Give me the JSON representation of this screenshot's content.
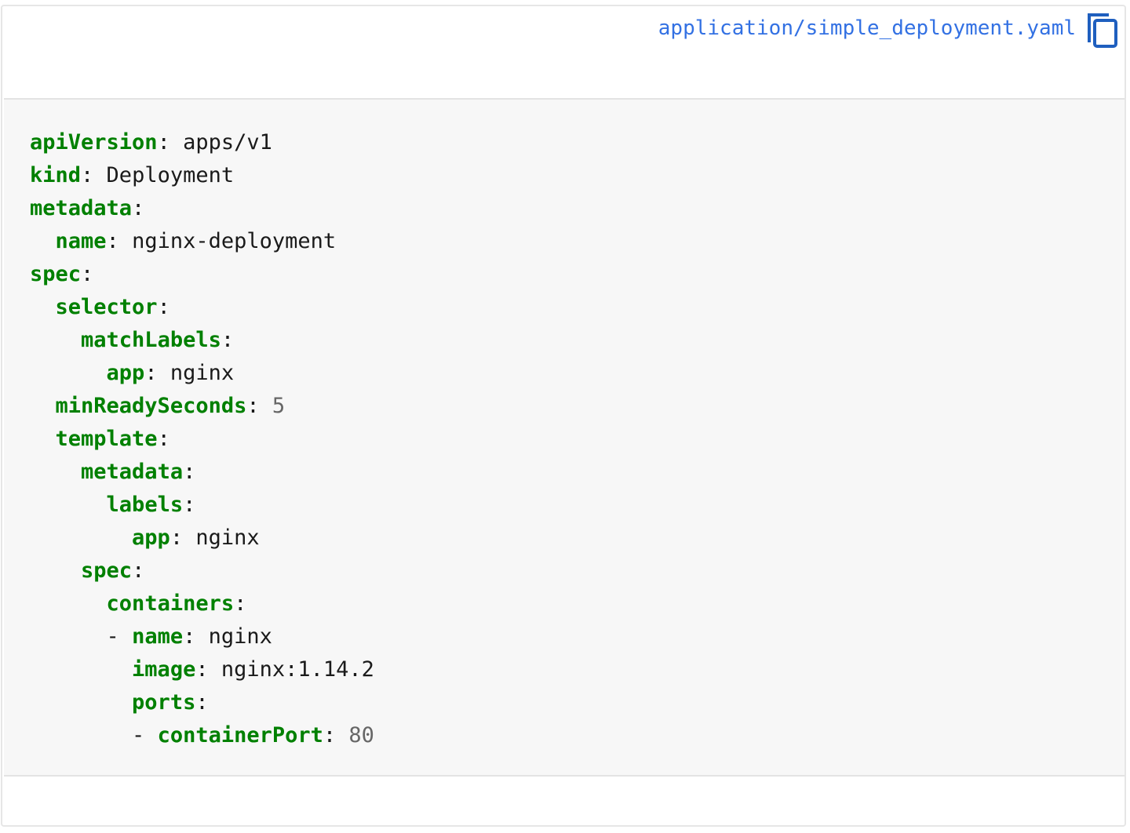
{
  "file": {
    "path": "application/simple_deployment.yaml",
    "copy_icon": "copy-icon",
    "link_color": "#3371e3"
  },
  "code": {
    "key_color": "#008000",
    "lines": [
      {
        "indent": "",
        "dash": "",
        "key": "apiVersion",
        "sep": ":",
        "value": " apps/v1",
        "type": "str"
      },
      {
        "indent": "",
        "dash": "",
        "key": "kind",
        "sep": ":",
        "value": " Deployment",
        "type": "str"
      },
      {
        "indent": "",
        "dash": "",
        "key": "metadata",
        "sep": ":",
        "value": "",
        "type": "str"
      },
      {
        "indent": "  ",
        "dash": "",
        "key": "name",
        "sep": ":",
        "value": " nginx-deployment",
        "type": "str"
      },
      {
        "indent": "",
        "dash": "",
        "key": "spec",
        "sep": ":",
        "value": "",
        "type": "str"
      },
      {
        "indent": "  ",
        "dash": "",
        "key": "selector",
        "sep": ":",
        "value": "",
        "type": "str"
      },
      {
        "indent": "    ",
        "dash": "",
        "key": "matchLabels",
        "sep": ":",
        "value": "",
        "type": "str"
      },
      {
        "indent": "      ",
        "dash": "",
        "key": "app",
        "sep": ":",
        "value": " nginx",
        "type": "str"
      },
      {
        "indent": "  ",
        "dash": "",
        "key": "minReadySeconds",
        "sep": ":",
        "value": " 5",
        "type": "num"
      },
      {
        "indent": "  ",
        "dash": "",
        "key": "template",
        "sep": ":",
        "value": "",
        "type": "str"
      },
      {
        "indent": "    ",
        "dash": "",
        "key": "metadata",
        "sep": ":",
        "value": "",
        "type": "str"
      },
      {
        "indent": "      ",
        "dash": "",
        "key": "labels",
        "sep": ":",
        "value": "",
        "type": "str"
      },
      {
        "indent": "        ",
        "dash": "",
        "key": "app",
        "sep": ":",
        "value": " nginx",
        "type": "str"
      },
      {
        "indent": "    ",
        "dash": "",
        "key": "spec",
        "sep": ":",
        "value": "",
        "type": "str"
      },
      {
        "indent": "      ",
        "dash": "",
        "key": "containers",
        "sep": ":",
        "value": "",
        "type": "str"
      },
      {
        "indent": "      ",
        "dash": "- ",
        "key": "name",
        "sep": ":",
        "value": " nginx",
        "type": "str"
      },
      {
        "indent": "        ",
        "dash": "",
        "key": "image",
        "sep": ":",
        "value": " nginx:1.14.2",
        "type": "str"
      },
      {
        "indent": "        ",
        "dash": "",
        "key": "ports",
        "sep": ":",
        "value": "",
        "type": "str"
      },
      {
        "indent": "        ",
        "dash": "- ",
        "key": "containerPort",
        "sep": ":",
        "value": " 80",
        "type": "num"
      }
    ]
  }
}
